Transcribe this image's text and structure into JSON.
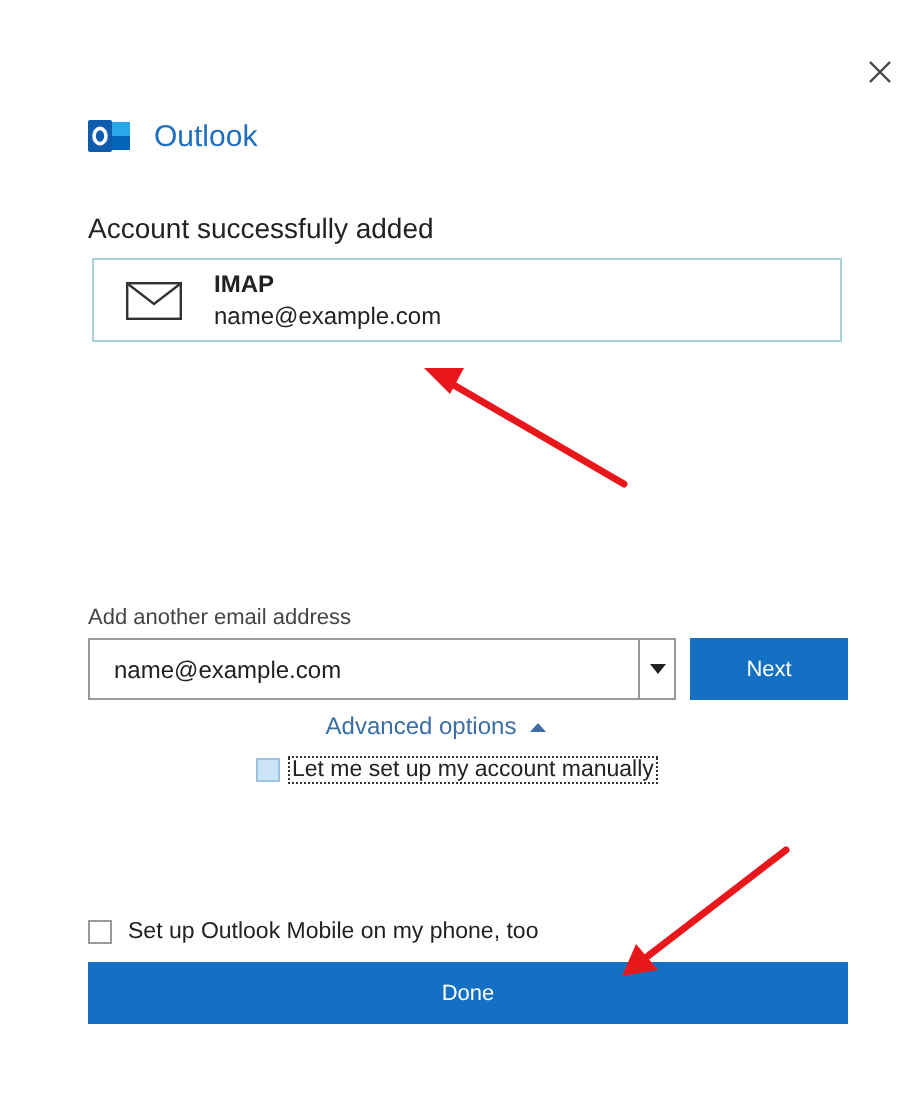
{
  "app": {
    "name": "Outlook"
  },
  "heading": "Account successfully added",
  "account": {
    "type": "IMAP",
    "email": "name@example.com"
  },
  "add_email": {
    "label": "Add another email address",
    "value": "name@example.com",
    "next_button": "Next"
  },
  "advanced_options": {
    "label": "Advanced options",
    "expanded": true
  },
  "manual_setup": {
    "label": "Let me set up my account manually",
    "checked": false,
    "focused": true
  },
  "mobile_setup": {
    "label": "Set up Outlook Mobile on my phone, too",
    "checked": false,
    "focused": false
  },
  "done_button": "Done"
}
